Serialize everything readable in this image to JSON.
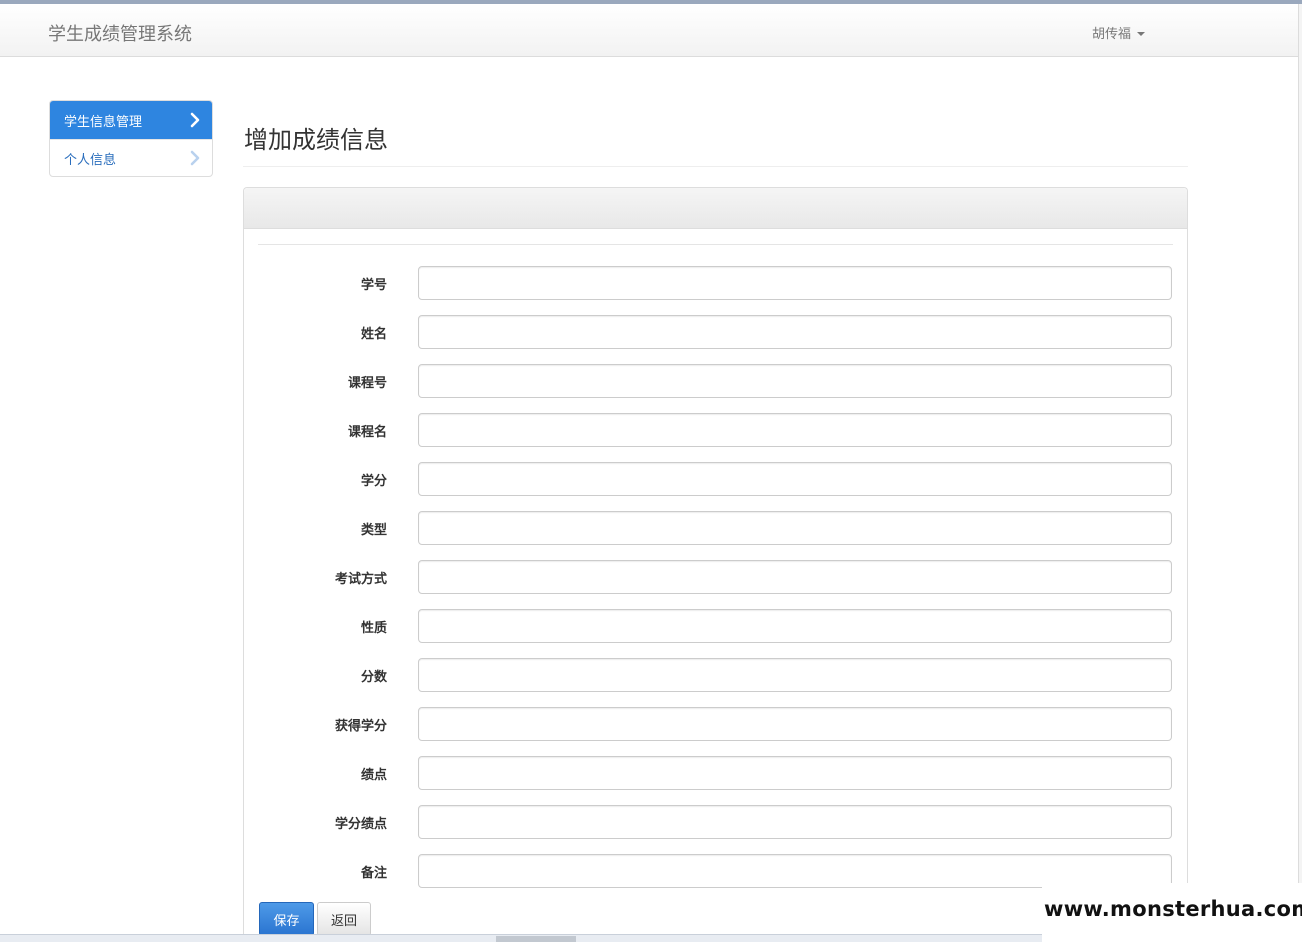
{
  "navbar": {
    "brand": "学生成绩管理系统",
    "user_name": "胡传福"
  },
  "sidebar": {
    "items": [
      {
        "label": "学生信息管理",
        "active": true
      },
      {
        "label": "个人信息",
        "active": false
      }
    ]
  },
  "main": {
    "page_title": "增加成绩信息",
    "form": {
      "fields": [
        {
          "label": "学号",
          "value": ""
        },
        {
          "label": "姓名",
          "value": ""
        },
        {
          "label": "课程号",
          "value": ""
        },
        {
          "label": "课程名",
          "value": ""
        },
        {
          "label": "学分",
          "value": ""
        },
        {
          "label": "类型",
          "value": ""
        },
        {
          "label": "考试方式",
          "value": ""
        },
        {
          "label": "性质",
          "value": ""
        },
        {
          "label": "分数",
          "value": ""
        },
        {
          "label": "获得学分",
          "value": ""
        },
        {
          "label": "绩点",
          "value": ""
        },
        {
          "label": "学分绩点",
          "value": ""
        },
        {
          "label": "备注",
          "value": ""
        }
      ],
      "save_label": "保存",
      "back_label": "返回"
    }
  },
  "watermark": "www.monsterhua.com",
  "colors": {
    "primary": "#2e85e0",
    "link": "#2a6ebd",
    "navbar_text": "#777777"
  }
}
